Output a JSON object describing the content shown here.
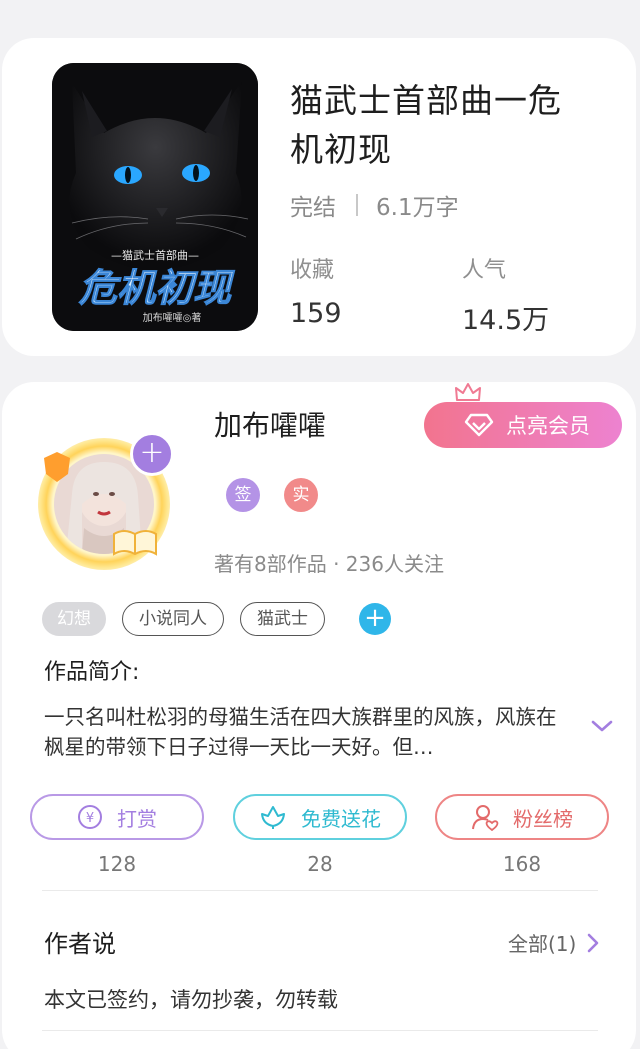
{
  "book": {
    "title": "猫武士首部曲一危机初现",
    "status": "完结",
    "word_count": "6.1万字",
    "favorites_label": "收藏",
    "favorites_value": "159",
    "popularity_label": "人气",
    "popularity_value": "14.5万",
    "cover": {
      "series_text": "—猫武士首部曲—",
      "title_text": "危机初现",
      "author_text": "加布嚯嚯◎著"
    }
  },
  "author": {
    "name": "加布嚯嚯",
    "vip_label": "点亮会员",
    "badge_signed": "签",
    "badge_verified": "实",
    "meta": "著有8部作品 · 236人关注",
    "tags": [
      "幻想",
      "小说同人",
      "猫武士"
    ]
  },
  "intro": {
    "heading": "作品简介:",
    "text": "一只名叫杜松羽的母猫生活在四大族群里的风族，风族在枫星的带领下日子过得一天比一天好。但…"
  },
  "actions": {
    "reward_label": "打赏",
    "reward_count": "128",
    "flower_label": "免费送花",
    "flower_count": "28",
    "fans_label": "粉丝榜",
    "fans_count": "168"
  },
  "author_says": {
    "heading": "作者说",
    "all_label": "全部(1)",
    "text": "本文已签约，请勿抄袭，勿转载"
  },
  "colors": {
    "purple": "#a37ee0",
    "teal": "#3cc4d8",
    "coral": "#ec6c6c",
    "vip_gradient_start": "#f2748e",
    "vip_gradient_end": "#ed82d0",
    "tag_plus": "#2fb6e9"
  },
  "icons": [
    "yen-coin-icon",
    "flower-icon",
    "fan-user-icon",
    "diamond-icon",
    "crown-icon",
    "chevron-down-icon",
    "chevron-right-icon"
  ]
}
